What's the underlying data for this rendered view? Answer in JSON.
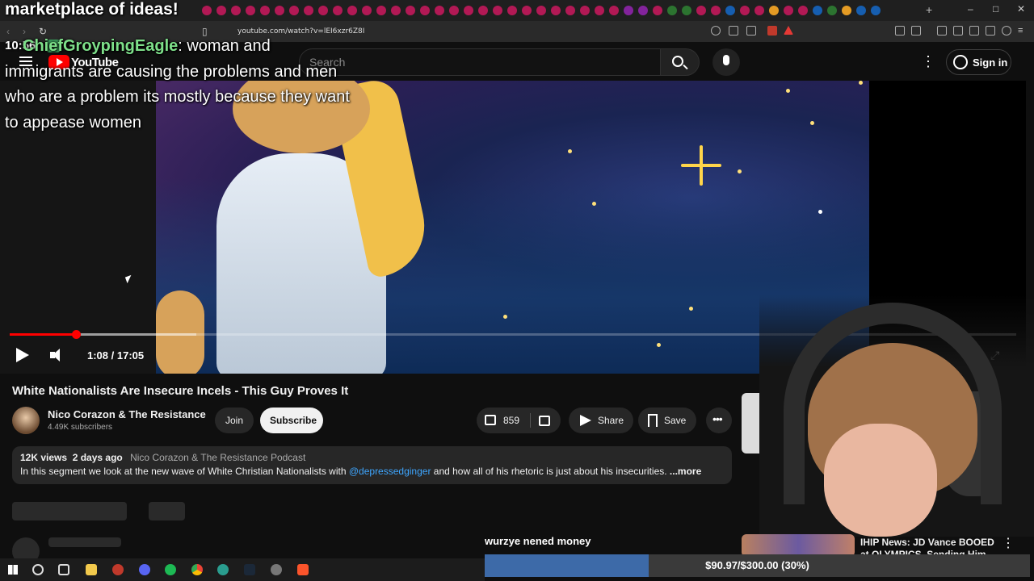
{
  "overlay": {
    "title": "marketplace of ideas!",
    "clock": "10:56",
    "chat_user": "ChiefGroypingEagle",
    "chat_message": ": woman and immigrants are causing the problems and men who are a problem its mostly because they want to appease women"
  },
  "browser": {
    "url": "youtube.com/watch?v=lEI6xzr6Z8I"
  },
  "header": {
    "logo_text": "YouTube",
    "search_placeholder": "Search",
    "sign_in_label": "Sign in"
  },
  "player": {
    "time": "1:08 / 17:05",
    "played_fraction": 0.066,
    "buffered_fraction": 0.185
  },
  "video": {
    "title": "White Nationalists Are Insecure Incels - This Guy Proves It",
    "channel_name": "Nico Corazon & The Resistance",
    "subscribers": "4.49K subscribers",
    "join_label": "Join",
    "subscribe_label": "Subscribe",
    "likes": "859",
    "share_label": "Share",
    "save_label": "Save"
  },
  "description": {
    "views": "12K views",
    "age": "2 days ago",
    "podcast": "Nico Corazon & The Resistance Podcast",
    "text_before": "In this segment we look at the new wave of White Christian Nationalists with ",
    "mention": "@depressedginger",
    "text_after": " and how all of his rhetoric is just about his insecurities. ",
    "more_label": "...more"
  },
  "recommendations": {
    "item2_title": "IHIP News: JD Vance BOOED at OLYMPICS, Sending Him Into"
  },
  "donation": {
    "latest_user": "wurzye nened money",
    "goal_text": "$90.97/$300.00 (30%)",
    "goal_fraction": 0.3
  },
  "colors": {
    "accent": "#ff0000",
    "link": "#3ea6ff",
    "chat_name": "#7ee08a",
    "goal_fill": "#3d6aa8"
  }
}
